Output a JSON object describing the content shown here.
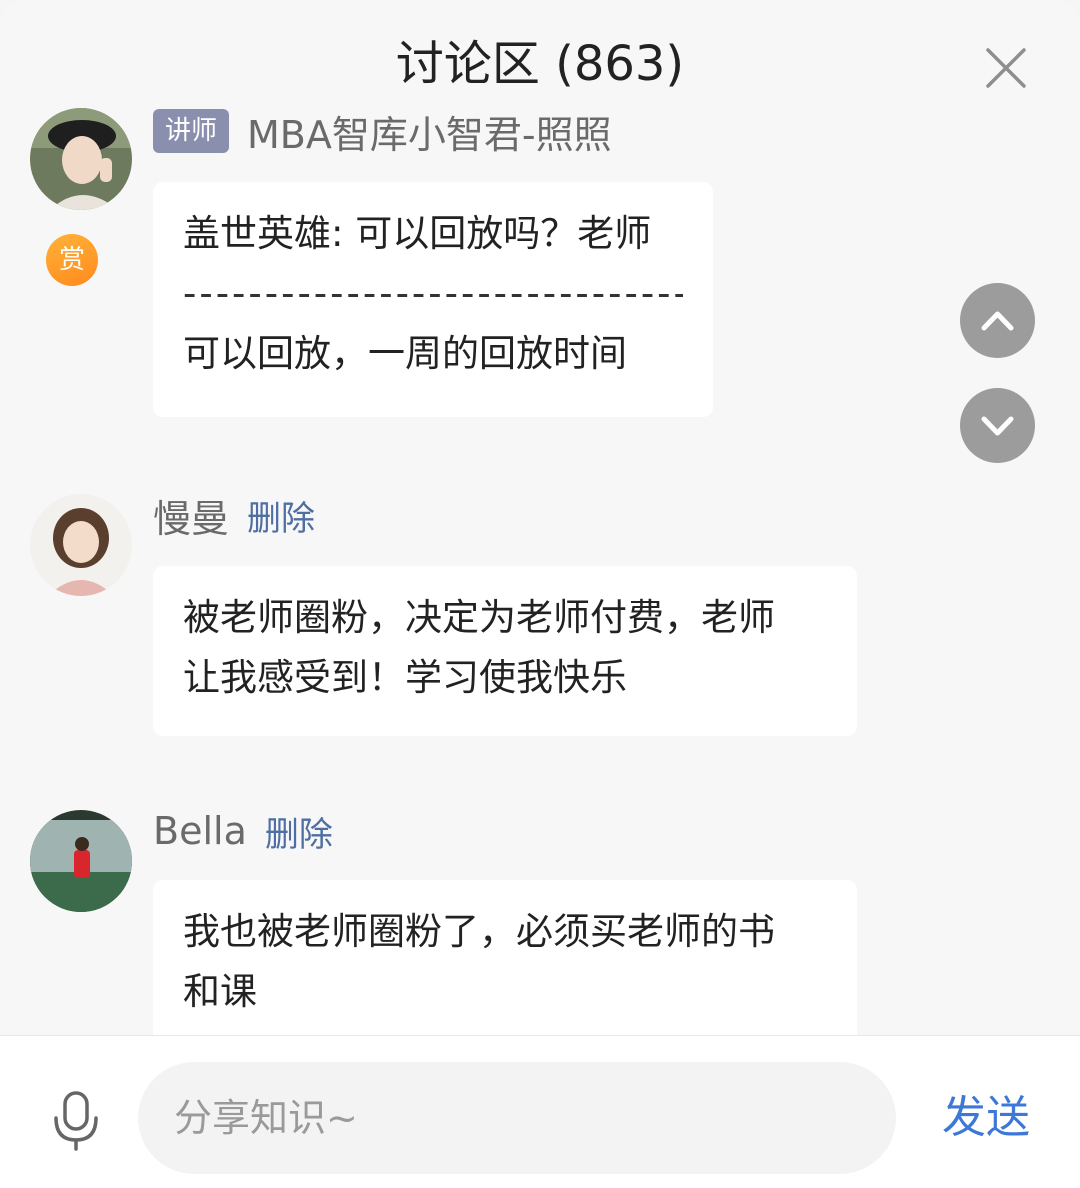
{
  "header": {
    "title": "讨论区 (863)"
  },
  "messages": [
    {
      "role_badge": "讲师",
      "name": "MBA智库小智君-照照",
      "reward_badge": "赏",
      "text_top": "盖世英雄: 可以回放吗？老师",
      "divider": "---------------------------------",
      "text_bottom": "可以回放，一周的回放时间"
    },
    {
      "name": "慢曼",
      "delete_label": "删除",
      "text_line1": "被老师圈粉，决定为老师付费，老师",
      "text_line2": "让我感受到！学习使我快乐"
    },
    {
      "name": "Bella",
      "delete_label": "删除",
      "text_line1": "我也被老师圈粉了，必须买老师的书",
      "text_line2": "和课"
    }
  ],
  "scroll": {
    "up_icon": "chevron-up-icon",
    "down_icon": "chevron-down-icon"
  },
  "composer": {
    "placeholder": "分享知识~",
    "send_label": "发送",
    "mic_icon": "microphone-icon"
  },
  "colors": {
    "accent_link": "#4f6fa3",
    "send": "#3d78d8",
    "role_badge": "#8a8fae",
    "reward_badge": "#ff9a2a",
    "scroll_button": "#9c9c9c"
  }
}
